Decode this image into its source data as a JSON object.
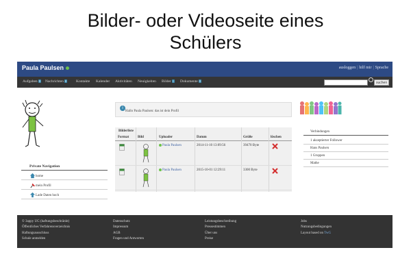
{
  "slide": {
    "title_line1": "Bilder- oder Videoseite eines",
    "title_line2": "Schülers"
  },
  "header": {
    "brand": "Paula Paulsen",
    "links": [
      "ausloggen",
      "hilf mir",
      "Sprache"
    ]
  },
  "nav": {
    "items": [
      {
        "label": "Aufgaben",
        "badge": "0"
      },
      {
        "label": "Nachrichten",
        "badge": "0"
      },
      {
        "label": "Kontakte",
        "badge": ""
      },
      {
        "label": "Kalender",
        "badge": ""
      },
      {
        "label": "Aktivitäten",
        "badge": ""
      },
      {
        "label": "Neuigkeiten",
        "badge": ""
      },
      {
        "label": "Bilder",
        "badge": "1"
      },
      {
        "label": "Dokumente",
        "badge": "0"
      }
    ],
    "search_placeholder": "",
    "search_button": "suchen"
  },
  "left": {
    "private_nav_title": "Private Navigation",
    "items": [
      {
        "label": "home",
        "icon": "home-icon"
      },
      {
        "label": "mein Profil",
        "icon": "pin-icon"
      },
      {
        "label": "Lade Daten hoch",
        "icon": "upload-icon"
      }
    ]
  },
  "notice": {
    "text": "Hallo Paula Paulsen: das ist dein Profil"
  },
  "table": {
    "title": "Bilderliste",
    "headers": [
      "Format",
      "Bild",
      "Uploader",
      "Datum",
      "Größe",
      "löschen"
    ],
    "rows": [
      {
        "uploader": "Paula Paulsen",
        "date": "2014-11-10 13:09:56",
        "size": "39470 Byte"
      },
      {
        "uploader": "Paula Paulsen",
        "date": "2015-10-01 12:29:11",
        "size": "3300 Byte"
      }
    ]
  },
  "right": {
    "connections_title": "Verbindungen",
    "items": [
      "1 akzeptierter Follower",
      "Hans Paulsen",
      "1 Gruppen",
      "Mathe"
    ]
  },
  "footer": {
    "col1": [
      "© 3appy UG (haftungsbeschränkt)",
      "Öffentliches Verfahrensverzeichnis",
      "Haftungsausschluss",
      "Schule anmelden"
    ],
    "col2": [
      "Datenschutz",
      "Impressum",
      "AGB",
      "Fragen und Antworten"
    ],
    "col3": [
      "Leistungsbeschreibung",
      "Pressestimmen",
      "Über uns",
      "Preise"
    ],
    "col4": [
      "Jobs",
      "Nutzungsbedingungen",
      "Layout based on"
    ],
    "layout_link": "TwG"
  }
}
